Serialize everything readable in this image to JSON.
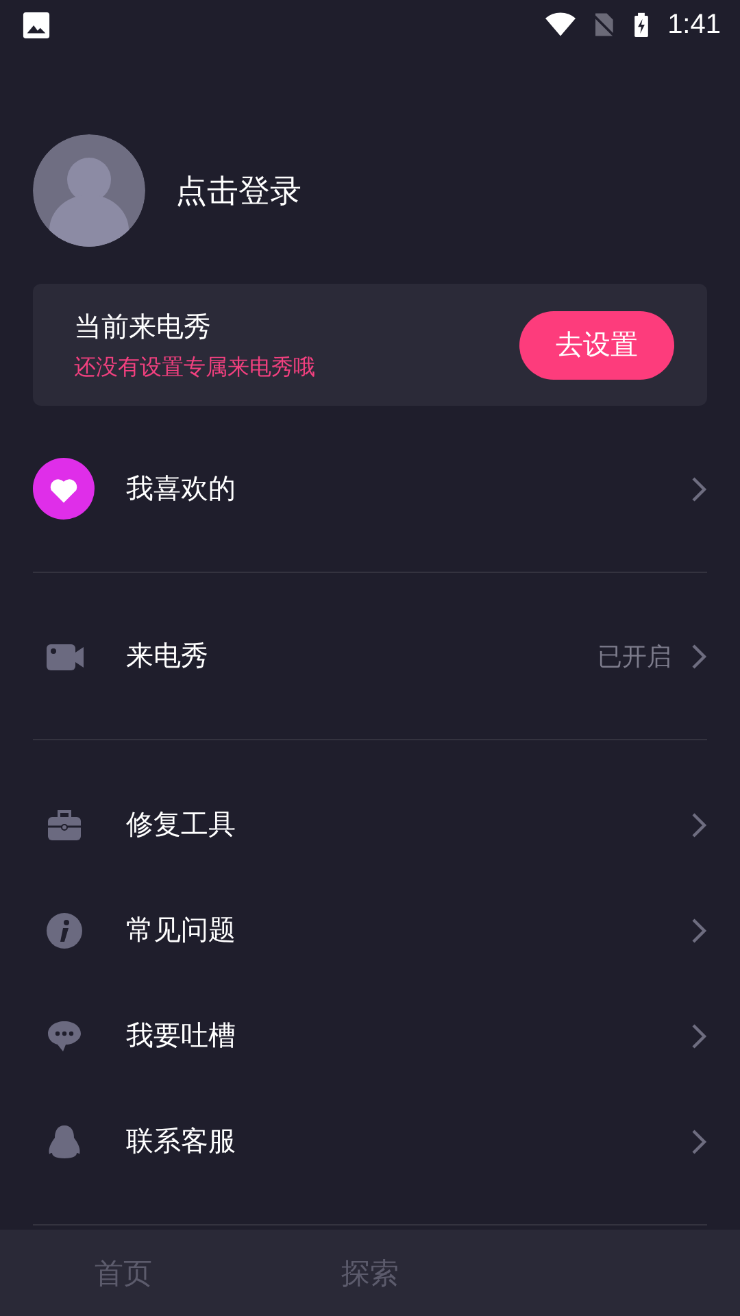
{
  "status_bar": {
    "time": "1:41"
  },
  "profile": {
    "login_label": "点击登录"
  },
  "ringtone_card": {
    "title": "当前来电秀",
    "subtitle": "还没有设置专属来电秀哦",
    "button": "去设置"
  },
  "menu_groups": [
    {
      "items": [
        {
          "label": "我喜欢的"
        }
      ]
    },
    {
      "items": [
        {
          "label": "来电秀",
          "value": "已开启"
        }
      ]
    },
    {
      "items": [
        {
          "label": "修复工具"
        },
        {
          "label": "常见问题"
        },
        {
          "label": "我要吐槽"
        },
        {
          "label": "联系客服"
        }
      ]
    }
  ],
  "tab_bar": {
    "tabs": [
      {
        "label": "首页",
        "selected": false
      },
      {
        "label": "探索",
        "selected": false
      }
    ]
  }
}
